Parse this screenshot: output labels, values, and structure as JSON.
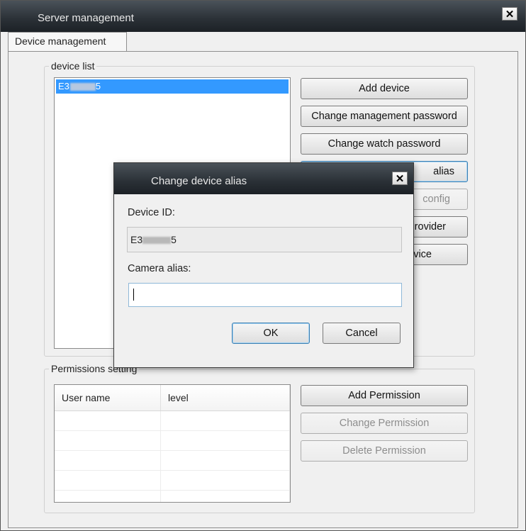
{
  "window": {
    "title": "Server management",
    "close_glyph": "✕"
  },
  "tabs": [
    {
      "label": "Device management"
    }
  ],
  "device_list": {
    "label": "device list",
    "items": [
      {
        "id_prefix": "E3",
        "id_suffix": "5"
      }
    ]
  },
  "device_buttons": {
    "add_device": "Add device",
    "change_management_password": "Change management password",
    "change_watch_password": "Change watch password",
    "change_alias_partial": "alias",
    "config_partial": "config",
    "provider_partial": "rovider",
    "device_partial": "vice"
  },
  "permissions": {
    "label": "Permissions setting",
    "columns": [
      "User name",
      "level"
    ],
    "rows": [
      [
        "",
        ""
      ],
      [
        "",
        ""
      ],
      [
        "",
        ""
      ],
      [
        "",
        ""
      ],
      [
        "",
        ""
      ]
    ],
    "buttons": {
      "add": "Add Permission",
      "change": "Change Permission",
      "delete": "Delete Permission"
    }
  },
  "dialog": {
    "title": "Change device alias",
    "close_glyph": "✕",
    "device_id_label": "Device ID:",
    "device_id_prefix": "E3",
    "device_id_suffix": "5",
    "camera_alias_label": "Camera alias:",
    "camera_alias_value": "",
    "ok_label": "OK",
    "cancel_label": "Cancel"
  },
  "colors": {
    "titlebar": "#2a3036",
    "selection": "#3399ff",
    "panel": "#f0f0f0"
  }
}
